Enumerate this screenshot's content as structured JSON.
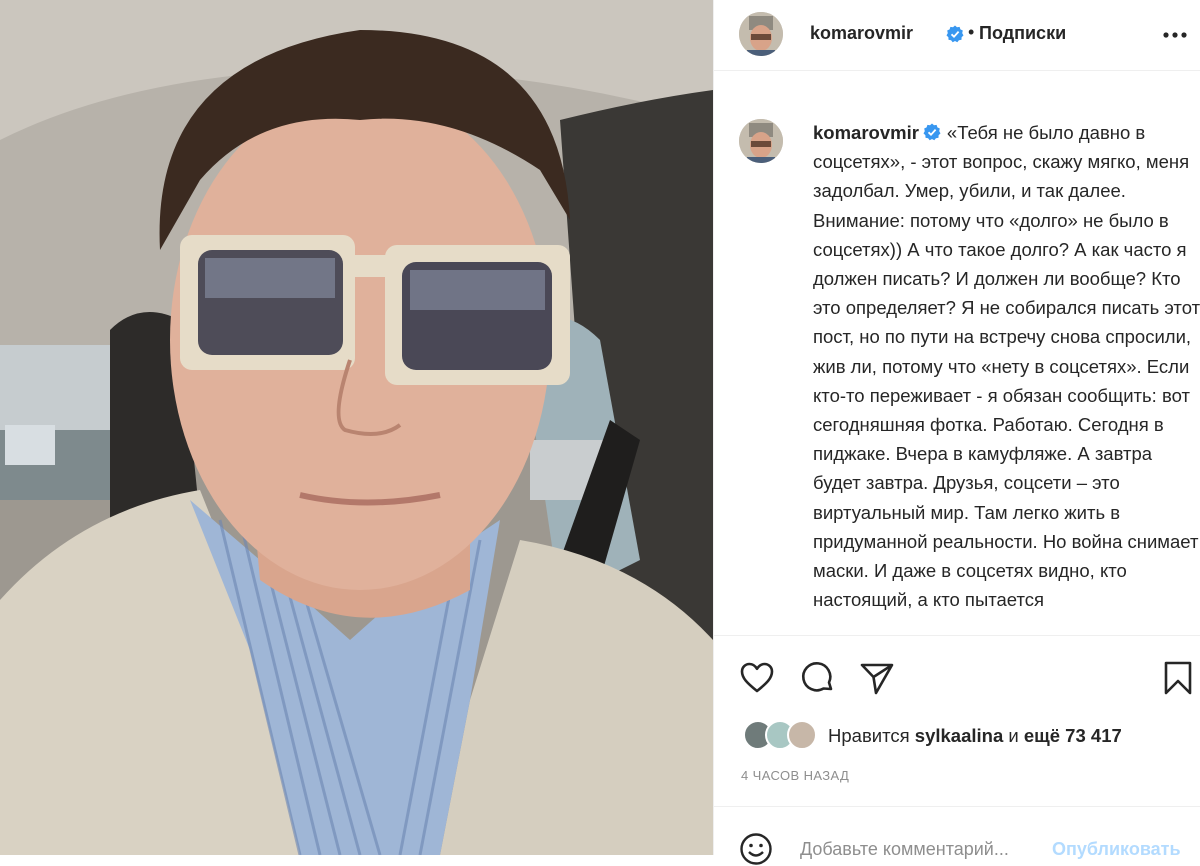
{
  "post": {
    "image_alt": "selfie-photo",
    "author": "komarovmir",
    "follow_status": "Подписки",
    "dot": "•",
    "caption_author": "komarovmir",
    "caption_text": "«Тебя не было давно в соцсетях», -  этот вопрос, скажу мягко, меня задолбал. Умер, убили, и так далее. Внимание: потому что «долго» не было в соцсетях)) А что такое долго? А как часто я должен писать? И должен ли вообще? Кто это определяет? Я не собирался писать этот пост, но по пути на встречу снова спросили, жив ли, потому что «нету в соцсетях». Если кто-то переживает - я обязан сообщить: вот сегодняшняя фотка. Работаю. Сегодня в пиджаке. Вчера в камуфляже. А завтра будет завтра. Друзья, соцсети –  это виртуальный мир. Там легко жить в придуманной реальности. Но война снимает маски. И даже в соцсетях видно, кто настоящий, а кто пытается",
    "likes_prefix": "Нравится",
    "likes_user": "sylkaalina",
    "likes_middle": "и",
    "likes_count": "ещё 73 417",
    "time_ago": "4 ЧАСОВ НАЗАД",
    "comment_placeholder": "Добавьте комментарий...",
    "publish_label": "Опубликовать"
  },
  "icons": {
    "verified": "verified-badge-icon",
    "more": "more-options-icon",
    "like": "heart-icon",
    "comment": "comment-bubble-icon",
    "share": "paper-plane-icon",
    "save": "bookmark-icon",
    "emoji": "smiley-icon"
  },
  "colors": {
    "verified_blue": "#3897f0",
    "publish_disabled": "#b3dbff",
    "secondary_text": "#8e8e8e"
  }
}
